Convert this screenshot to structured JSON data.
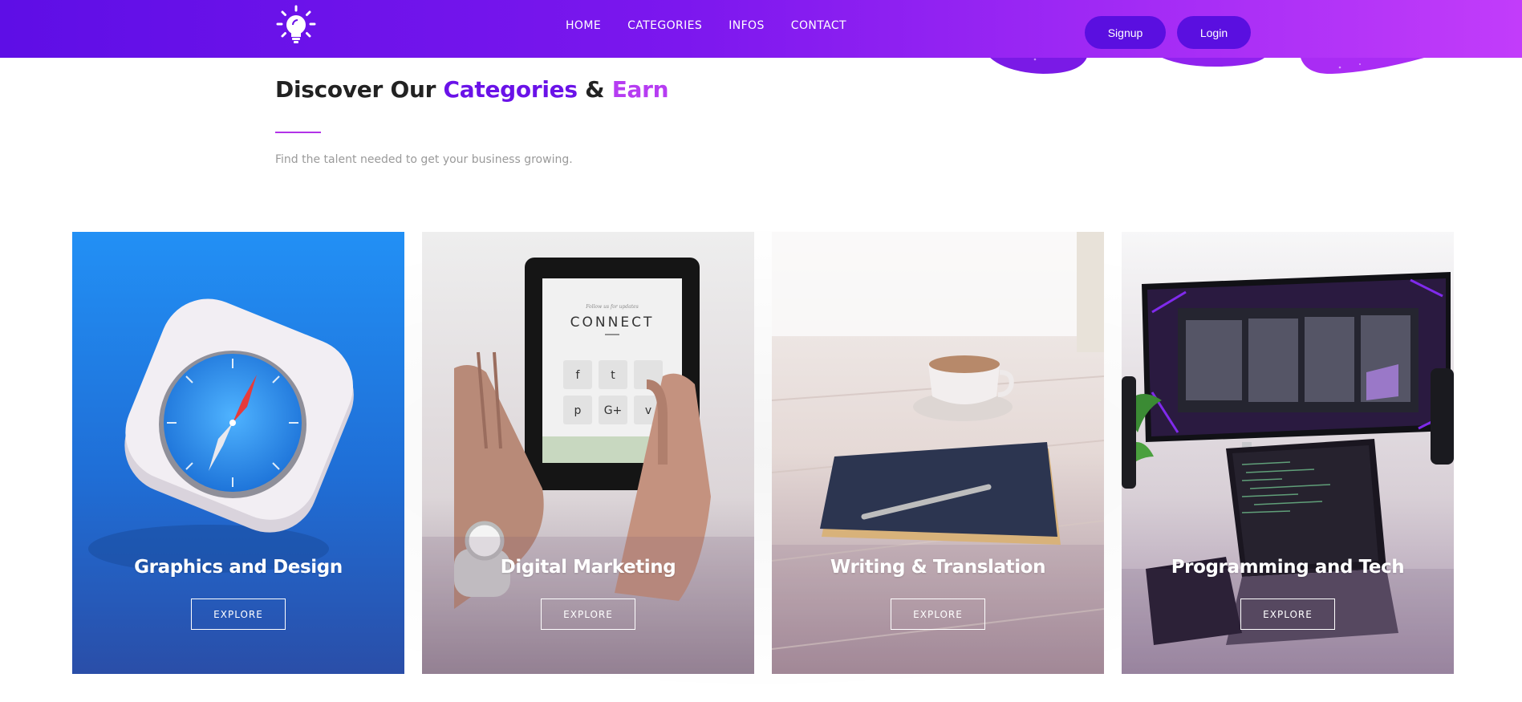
{
  "header": {
    "nav": [
      "HOME",
      "CATEGORIES",
      "INFOS",
      "CONTACT"
    ],
    "signup_label": "Signup",
    "login_label": "Login"
  },
  "section": {
    "title_part1": "Discover Our ",
    "title_part2": "Categories",
    "title_part3": " & ",
    "title_part4": "Earn",
    "subtitle": "Find the talent needed to get your business growing."
  },
  "cards": [
    {
      "title": "Graphics and Design",
      "button": "EXPLORE",
      "image": "compass-app-icon"
    },
    {
      "title": "Digital Marketing",
      "button": "EXPLORE",
      "image": "tablet-in-hands",
      "tablet_heading": "CONNECT",
      "tablet_caption": "Follow us for updates"
    },
    {
      "title": "Writing & Translation",
      "button": "EXPLORE",
      "image": "notebook-and-coffee"
    },
    {
      "title": "Programming and Tech",
      "button": "EXPLORE",
      "image": "monitor-and-laptop"
    }
  ],
  "colors": {
    "brand_purple": "#6a12e8",
    "accent_pink": "#b63cf2",
    "header_start": "#5e0ee6",
    "header_end": "#c23cfa"
  }
}
